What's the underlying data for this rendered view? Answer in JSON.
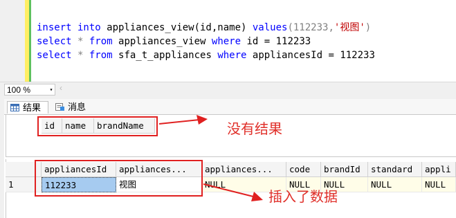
{
  "editor": {
    "lines": [
      {
        "kw1": "insert into",
        "rest": " appliances_view(id,name) ",
        "kw2": "values",
        "args": "(112233,",
        "str": "'视图'",
        "close": ")"
      },
      {
        "kw1": "select",
        "star": " * ",
        "kw2": "from",
        "table": " appliances_view ",
        "kw3": "where",
        "cond": " id = 112233"
      },
      {
        "kw1": "select",
        "star": " * ",
        "kw2": "from",
        "table": " sfa_t_appliances ",
        "kw3": "where",
        "cond": " appliancesId = 112233"
      }
    ]
  },
  "zoom": {
    "value": "100 %",
    "arrow": "▾",
    "scroll_left": "‹"
  },
  "tabs": {
    "results": "结果",
    "messages": "消息"
  },
  "grid1": {
    "headers": [
      "id",
      "name",
      "brandName"
    ]
  },
  "grid2": {
    "headers": [
      "appliancesId",
      "appliances...",
      "appliances...",
      "code",
      "brandId",
      "standard",
      "appli"
    ],
    "row_number": "1",
    "row": [
      "112233",
      "视图",
      "NULL",
      "NULL",
      "NULL",
      "NULL",
      "NULL"
    ]
  },
  "annotations": {
    "no_result": "没有结果",
    "inserted": "插入了数据"
  },
  "colors": {
    "keyword": "#0000ff",
    "string": "#c00000",
    "annotation_red": "#e02020",
    "selected_cell": "#a6cbf0"
  }
}
